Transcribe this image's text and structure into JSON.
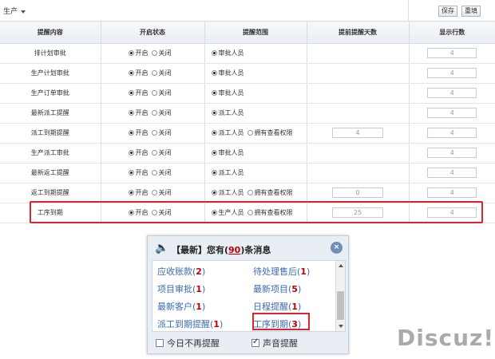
{
  "toolbar": {
    "module": "生产",
    "save_label": "保存",
    "reset_label": "重填"
  },
  "table": {
    "headers": [
      "提醒内容",
      "开启状态",
      "提醒范围",
      "提前提醒天数",
      "显示行数"
    ],
    "status_on": "开启",
    "status_off": "关闭",
    "rows": [
      {
        "name": "排计划审批",
        "scope": "审批人员",
        "extra": "",
        "days": "",
        "lines": "4",
        "status": "on"
      },
      {
        "name": "生产计划审批",
        "scope": "审批人员",
        "extra": "",
        "days": "",
        "lines": "4",
        "status": "on"
      },
      {
        "name": "生产订单审批",
        "scope": "审批人员",
        "extra": "",
        "days": "",
        "lines": "4",
        "status": "on"
      },
      {
        "name": "最新派工提醒",
        "scope": "派工人员",
        "extra": "",
        "days": "",
        "lines": "4",
        "status": "on"
      },
      {
        "name": "派工到期提醒",
        "scope": "派工人员",
        "extra": "拥有查看权限",
        "days": "4",
        "lines": "4",
        "status": "on"
      },
      {
        "name": "生产派工审批",
        "scope": "审批人员",
        "extra": "",
        "days": "",
        "lines": "4",
        "status": "on"
      },
      {
        "name": "最新返工提醒",
        "scope": "派工人员",
        "extra": "",
        "days": "",
        "lines": "4",
        "status": "on"
      },
      {
        "name": "返工到期提醒",
        "scope": "派工人员",
        "extra": "拥有查看权限",
        "days": "0",
        "lines": "4",
        "status": "on"
      },
      {
        "name": "工序到期",
        "scope": "生产人员",
        "extra": "拥有查看权限",
        "days": "25",
        "lines": "4",
        "status": "on"
      }
    ]
  },
  "popup": {
    "title_prefix": "【最新】您有(",
    "count": "90",
    "title_suffix": ")条消息",
    "close_label": "×",
    "items": [
      {
        "label": "应收账款",
        "count": "2"
      },
      {
        "label": "待处理售后",
        "count": "1"
      },
      {
        "label": "项目审批",
        "count": "1"
      },
      {
        "label": "最新项目",
        "count": "5"
      },
      {
        "label": "最新客户",
        "count": "1"
      },
      {
        "label": "日程提醒",
        "count": "1"
      },
      {
        "label": "派工到期提醒",
        "count": "1"
      },
      {
        "label": "工序到期",
        "count": "3"
      }
    ],
    "no_remind_today": "今日不再提醒",
    "sound_remind": "声音提醒"
  },
  "watermark": "Discuz!",
  "colors": {
    "highlight": "#d9252b",
    "link": "#3a6bb0",
    "count": "#c00000"
  }
}
